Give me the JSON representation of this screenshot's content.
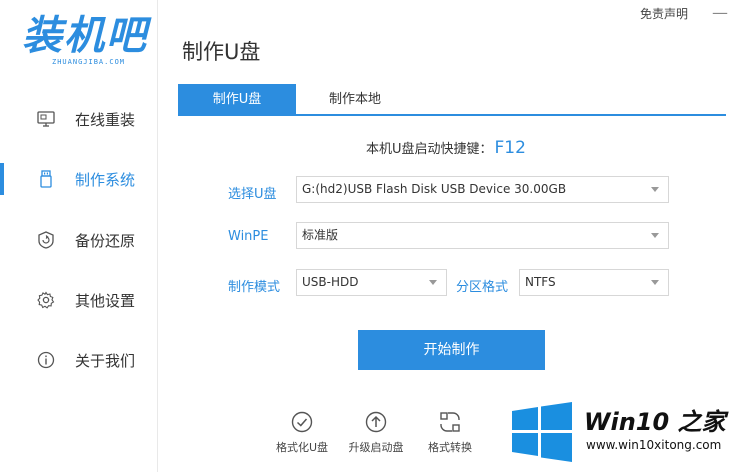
{
  "window": {
    "disclaimer_link": "免责声明",
    "close_glyph": "—"
  },
  "logo": {
    "title": "装机吧",
    "subtitle": "ZHUANGJIBA.COM"
  },
  "sidebar": {
    "items": [
      {
        "label": "在线重装",
        "icon": "monitor-icon",
        "active": false
      },
      {
        "label": "制作系统",
        "icon": "usb-icon",
        "active": true
      },
      {
        "label": "备份还原",
        "icon": "backup-icon",
        "active": false
      },
      {
        "label": "其他设置",
        "icon": "gear-icon",
        "active": false
      },
      {
        "label": "关于我们",
        "icon": "info-icon",
        "active": false
      }
    ]
  },
  "main": {
    "title": "制作U盘",
    "tabs": [
      {
        "label": "制作U盘",
        "active": true
      },
      {
        "label": "制作本地",
        "active": false
      }
    ],
    "hotkey": {
      "label": "本机U盘启动快捷键：",
      "key": "F12"
    },
    "form": {
      "usb_label": "选择U盘",
      "usb_value": "G:(hd2)USB Flash Disk USB Device 30.00GB",
      "winpe_label": "WinPE",
      "winpe_value": "标准版",
      "mode_label": "制作模式",
      "mode_value": "USB-HDD",
      "partition_label": "分区格式",
      "partition_value": "NTFS"
    },
    "start_button": "开始制作"
  },
  "tools": [
    {
      "label": "格式化U盘",
      "icon": "check-circle-icon"
    },
    {
      "label": "升级启动盘",
      "icon": "upgrade-circle-icon"
    },
    {
      "label": "格式转换",
      "icon": "convert-icon"
    }
  ],
  "watermark": {
    "title": "Win10 之家",
    "url": "www.win10xitong.com"
  },
  "colors": {
    "accent": "#2c8ddf"
  }
}
